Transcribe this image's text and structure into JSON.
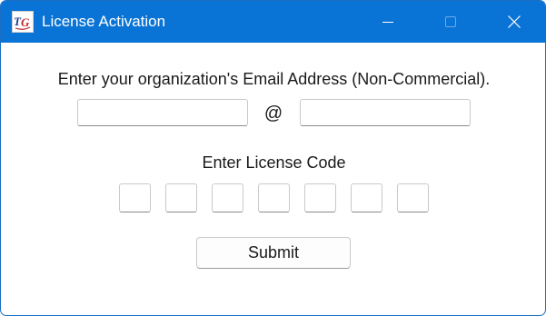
{
  "window": {
    "title": "License Activation",
    "app_icon": "tg-logo-icon",
    "titlebar_color": "#0a74d6",
    "controls": [
      "minimize-icon",
      "maximize-icon",
      "close-icon"
    ]
  },
  "email": {
    "label": "Enter your organization's Email Address (Non-Commercial).",
    "user_value": "",
    "at_sign": "@",
    "domain_value": ""
  },
  "license": {
    "label": "Enter License Code",
    "segments": [
      "",
      "",
      "",
      "",
      "",
      "",
      ""
    ]
  },
  "submit": {
    "label": "Submit"
  }
}
